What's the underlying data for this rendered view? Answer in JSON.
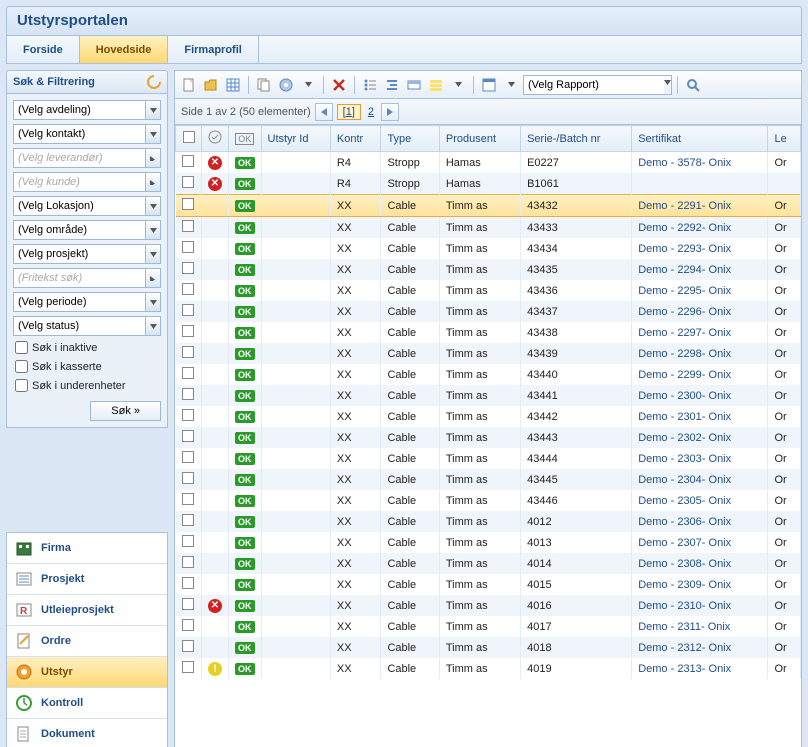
{
  "app_title": "Utstyrsportalen",
  "tabs": [
    "Forside",
    "Hovedside",
    "Firmaprofil"
  ],
  "active_tab": 1,
  "filter_panel": {
    "title": "Søk & Filtrering",
    "combos": [
      {
        "value": "(Velg avdeling)",
        "kind": "dropdown",
        "ph": false
      },
      {
        "value": "(Velg kontakt)",
        "kind": "dropdown",
        "ph": false
      },
      {
        "value": "(Velg leverandør)",
        "kind": "arrow",
        "ph": true
      },
      {
        "value": "(Velg kunde)",
        "kind": "arrow",
        "ph": true
      },
      {
        "value": "(Velg Lokasjon)",
        "kind": "dropdown",
        "ph": false
      },
      {
        "value": "(Velg område)",
        "kind": "dropdown",
        "ph": false
      },
      {
        "value": "(Velg prosjekt)",
        "kind": "dropdown",
        "ph": false
      },
      {
        "value": "(Fritekst søk)",
        "kind": "arrow",
        "ph": true
      },
      {
        "value": "(Velg periode)",
        "kind": "dropdown",
        "ph": false
      },
      {
        "value": "(Velg status)",
        "kind": "dropdown",
        "ph": false
      }
    ],
    "checkboxes": [
      "Søk i inaktive",
      "Søk i kasserte",
      "Søk i underenheter"
    ],
    "search_btn": "Søk »"
  },
  "nav_items": [
    {
      "label": "Firma",
      "icon": "firma"
    },
    {
      "label": "Prosjekt",
      "icon": "prosjekt"
    },
    {
      "label": "Utleieprosjekt",
      "icon": "utleie"
    },
    {
      "label": "Ordre",
      "icon": "ordre"
    },
    {
      "label": "Utstyr",
      "icon": "utstyr",
      "active": true
    },
    {
      "label": "Kontroll",
      "icon": "kontroll"
    },
    {
      "label": "Dokument",
      "icon": "dokument"
    }
  ],
  "toolbar": {
    "report_value": "(Velg Rapport)"
  },
  "pager": {
    "text": "Side 1 av 2 (50 elementer)",
    "current": "1",
    "next": "2"
  },
  "columns": [
    "",
    "",
    "",
    "Utstyr Id",
    "Kontr",
    "Type",
    "Produsent",
    "Serie-/Batch nr",
    "Sertifikat",
    "Le"
  ],
  "rows": [
    {
      "status": "err",
      "ok": "OK",
      "id": "",
      "kontr": "R4",
      "type": "Stropp",
      "prod": "Hamas",
      "serie": "E0227",
      "sert": "Demo - 3578- Onix",
      "le": "Or"
    },
    {
      "status": "err",
      "ok": "OK",
      "id": "",
      "kontr": "R4",
      "type": "Stropp",
      "prod": "Hamas",
      "serie": "B1061",
      "sert": "",
      "le": ""
    },
    {
      "status": "",
      "ok": "OK",
      "id": "",
      "kontr": "XX",
      "type": "Cable",
      "prod": "Timm as",
      "serie": "43432",
      "sert": "Demo - 2291- Onix",
      "le": "Or",
      "sel": true
    },
    {
      "status": "",
      "ok": "OK",
      "id": "",
      "kontr": "XX",
      "type": "Cable",
      "prod": "Timm as",
      "serie": "43433",
      "sert": "Demo - 2292- Onix",
      "le": "Or"
    },
    {
      "status": "",
      "ok": "OK",
      "id": "",
      "kontr": "XX",
      "type": "Cable",
      "prod": "Timm as",
      "serie": "43434",
      "sert": "Demo - 2293- Onix",
      "le": "Or"
    },
    {
      "status": "",
      "ok": "OK",
      "id": "",
      "kontr": "XX",
      "type": "Cable",
      "prod": "Timm as",
      "serie": "43435",
      "sert": "Demo - 2294- Onix",
      "le": "Or"
    },
    {
      "status": "",
      "ok": "OK",
      "id": "",
      "kontr": "XX",
      "type": "Cable",
      "prod": "Timm as",
      "serie": "43436",
      "sert": "Demo - 2295- Onix",
      "le": "Or"
    },
    {
      "status": "",
      "ok": "OK",
      "id": "",
      "kontr": "XX",
      "type": "Cable",
      "prod": "Timm as",
      "serie": "43437",
      "sert": "Demo - 2296- Onix",
      "le": "Or"
    },
    {
      "status": "",
      "ok": "OK",
      "id": "",
      "kontr": "XX",
      "type": "Cable",
      "prod": "Timm as",
      "serie": "43438",
      "sert": "Demo - 2297- Onix",
      "le": "Or"
    },
    {
      "status": "",
      "ok": "OK",
      "id": "",
      "kontr": "XX",
      "type": "Cable",
      "prod": "Timm as",
      "serie": "43439",
      "sert": "Demo - 2298- Onix",
      "le": "Or"
    },
    {
      "status": "",
      "ok": "OK",
      "id": "",
      "kontr": "XX",
      "type": "Cable",
      "prod": "Timm as",
      "serie": "43440",
      "sert": "Demo - 2299- Onix",
      "le": "Or"
    },
    {
      "status": "",
      "ok": "OK",
      "id": "",
      "kontr": "XX",
      "type": "Cable",
      "prod": "Timm as",
      "serie": "43441",
      "sert": "Demo - 2300- Onix",
      "le": "Or"
    },
    {
      "status": "",
      "ok": "OK",
      "id": "",
      "kontr": "XX",
      "type": "Cable",
      "prod": "Timm as",
      "serie": "43442",
      "sert": "Demo - 2301- Onix",
      "le": "Or"
    },
    {
      "status": "",
      "ok": "OK",
      "id": "",
      "kontr": "XX",
      "type": "Cable",
      "prod": "Timm as",
      "serie": "43443",
      "sert": "Demo - 2302- Onix",
      "le": "Or"
    },
    {
      "status": "",
      "ok": "OK",
      "id": "",
      "kontr": "XX",
      "type": "Cable",
      "prod": "Timm as",
      "serie": "43444",
      "sert": "Demo - 2303- Onix",
      "le": "Or"
    },
    {
      "status": "",
      "ok": "OK",
      "id": "",
      "kontr": "XX",
      "type": "Cable",
      "prod": "Timm as",
      "serie": "43445",
      "sert": "Demo - 2304- Onix",
      "le": "Or"
    },
    {
      "status": "",
      "ok": "OK",
      "id": "",
      "kontr": "XX",
      "type": "Cable",
      "prod": "Timm as",
      "serie": "43446",
      "sert": "Demo - 2305- Onix",
      "le": "Or"
    },
    {
      "status": "",
      "ok": "OK",
      "id": "",
      "kontr": "XX",
      "type": "Cable",
      "prod": "Timm as",
      "serie": "4012",
      "sert": "Demo - 2306- Onix",
      "le": "Or"
    },
    {
      "status": "",
      "ok": "OK",
      "id": "",
      "kontr": "XX",
      "type": "Cable",
      "prod": "Timm as",
      "serie": "4013",
      "sert": "Demo - 2307- Onix",
      "le": "Or"
    },
    {
      "status": "",
      "ok": "OK",
      "id": "",
      "kontr": "XX",
      "type": "Cable",
      "prod": "Timm as",
      "serie": "4014",
      "sert": "Demo - 2308- Onix",
      "le": "Or"
    },
    {
      "status": "",
      "ok": "OK",
      "id": "",
      "kontr": "XX",
      "type": "Cable",
      "prod": "Timm as",
      "serie": "4015",
      "sert": "Demo - 2309- Onix",
      "le": "Or"
    },
    {
      "status": "err",
      "ok": "OK",
      "id": "",
      "kontr": "XX",
      "type": "Cable",
      "prod": "Timm as",
      "serie": "4016",
      "sert": "Demo - 2310- Onix",
      "le": "Or"
    },
    {
      "status": "",
      "ok": "OK",
      "id": "",
      "kontr": "XX",
      "type": "Cable",
      "prod": "Timm as",
      "serie": "4017",
      "sert": "Demo - 2311- Onix",
      "le": "Or"
    },
    {
      "status": "",
      "ok": "OK",
      "id": "",
      "kontr": "XX",
      "type": "Cable",
      "prod": "Timm as",
      "serie": "4018",
      "sert": "Demo - 2312- Onix",
      "le": "Or"
    },
    {
      "status": "warn",
      "ok": "OK",
      "id": "",
      "kontr": "XX",
      "type": "Cable",
      "prod": "Timm as",
      "serie": "4019",
      "sert": "Demo - 2313- Onix",
      "le": "Or"
    }
  ]
}
